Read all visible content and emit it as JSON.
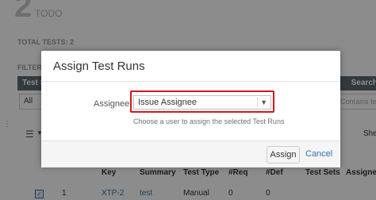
{
  "background": {
    "big_number": "2",
    "status_label": "TODO",
    "total_tests": "TOTAL TESTS: 2",
    "filters_label": "FILTERS",
    "filter_header_left": "Test S",
    "filter_header_right": "Search",
    "filter_select_value": "All",
    "search_placeholder": "Contains te",
    "view_label": "She",
    "table": {
      "headers": [
        "Key",
        "Summary",
        "Test Type",
        "#Req",
        "#Def",
        "Test Sets",
        "Assignee"
      ],
      "rows": [
        [
          "1",
          "XTP-2",
          "test",
          "Manual",
          "0",
          "0",
          ""
        ]
      ]
    }
  },
  "dialog": {
    "title": "Assign Test Runs",
    "assignee_label": "Assignee",
    "assignee_value": "Issue Assignee",
    "help_text": "Choose a user to assign the selected Test Runs",
    "assign_button": "Assign",
    "cancel_link": "Cancel"
  },
  "colors": {
    "highlight_border": "#d8141c",
    "link": "#3572b0",
    "overlay": "rgba(0,0,0,0.45)"
  }
}
